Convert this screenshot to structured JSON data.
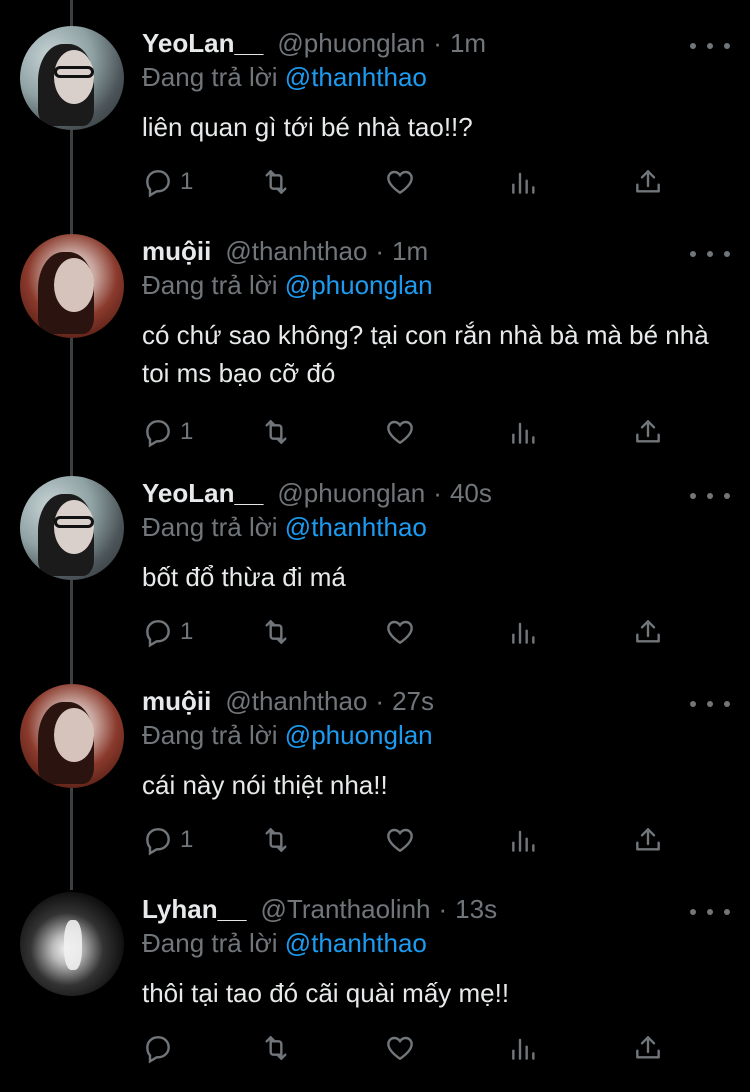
{
  "tweets": [
    {
      "name": "YeoLan__",
      "handle": "@phuonglan",
      "time": "1m",
      "reply_prefix": "Đang trả lời",
      "reply_to": "@thanhthao",
      "text": "liên quan gì tới bé nhà tao!!?",
      "reply_count": "1",
      "avatar": "yeo"
    },
    {
      "name": "muộii",
      "handle": "@thanhthao",
      "time": "1m",
      "reply_prefix": "Đang trả lời",
      "reply_to": "@phuonglan",
      "text": "có chứ sao không? tại con rắn nhà bà mà bé nhà toi ms bạo cỡ đó",
      "reply_count": "1",
      "avatar": "muo"
    },
    {
      "name": "YeoLan__",
      "handle": "@phuonglan",
      "time": "40s",
      "reply_prefix": "Đang trả lời",
      "reply_to": "@thanhthao",
      "text": "bốt đổ thừa đi má",
      "reply_count": "1",
      "avatar": "yeo"
    },
    {
      "name": "muộii",
      "handle": "@thanhthao",
      "time": "27s",
      "reply_prefix": "Đang trả lời",
      "reply_to": "@phuonglan",
      "text": "cái này nói thiệt nha!!",
      "reply_count": "1",
      "avatar": "muo"
    },
    {
      "name": "Lyhan__",
      "handle": "@Tranthaolinh",
      "time": "13s",
      "reply_prefix": "Đang trả lời",
      "reply_to": "@thanhthao",
      "text": "thôi tại tao đó cãi quài mấy mẹ!!",
      "reply_count": "",
      "avatar": "ly"
    }
  ],
  "separator": "·",
  "colors": {
    "background": "#000000",
    "text": "#e7e9ea",
    "muted": "#71767b",
    "link": "#1d9bf0",
    "thread_line": "#3d4043"
  },
  "icons": {
    "reply": "reply-icon",
    "retweet": "retweet-icon",
    "like": "heart-icon",
    "stats": "stats-icon",
    "share": "share-icon",
    "more": "more-icon"
  }
}
